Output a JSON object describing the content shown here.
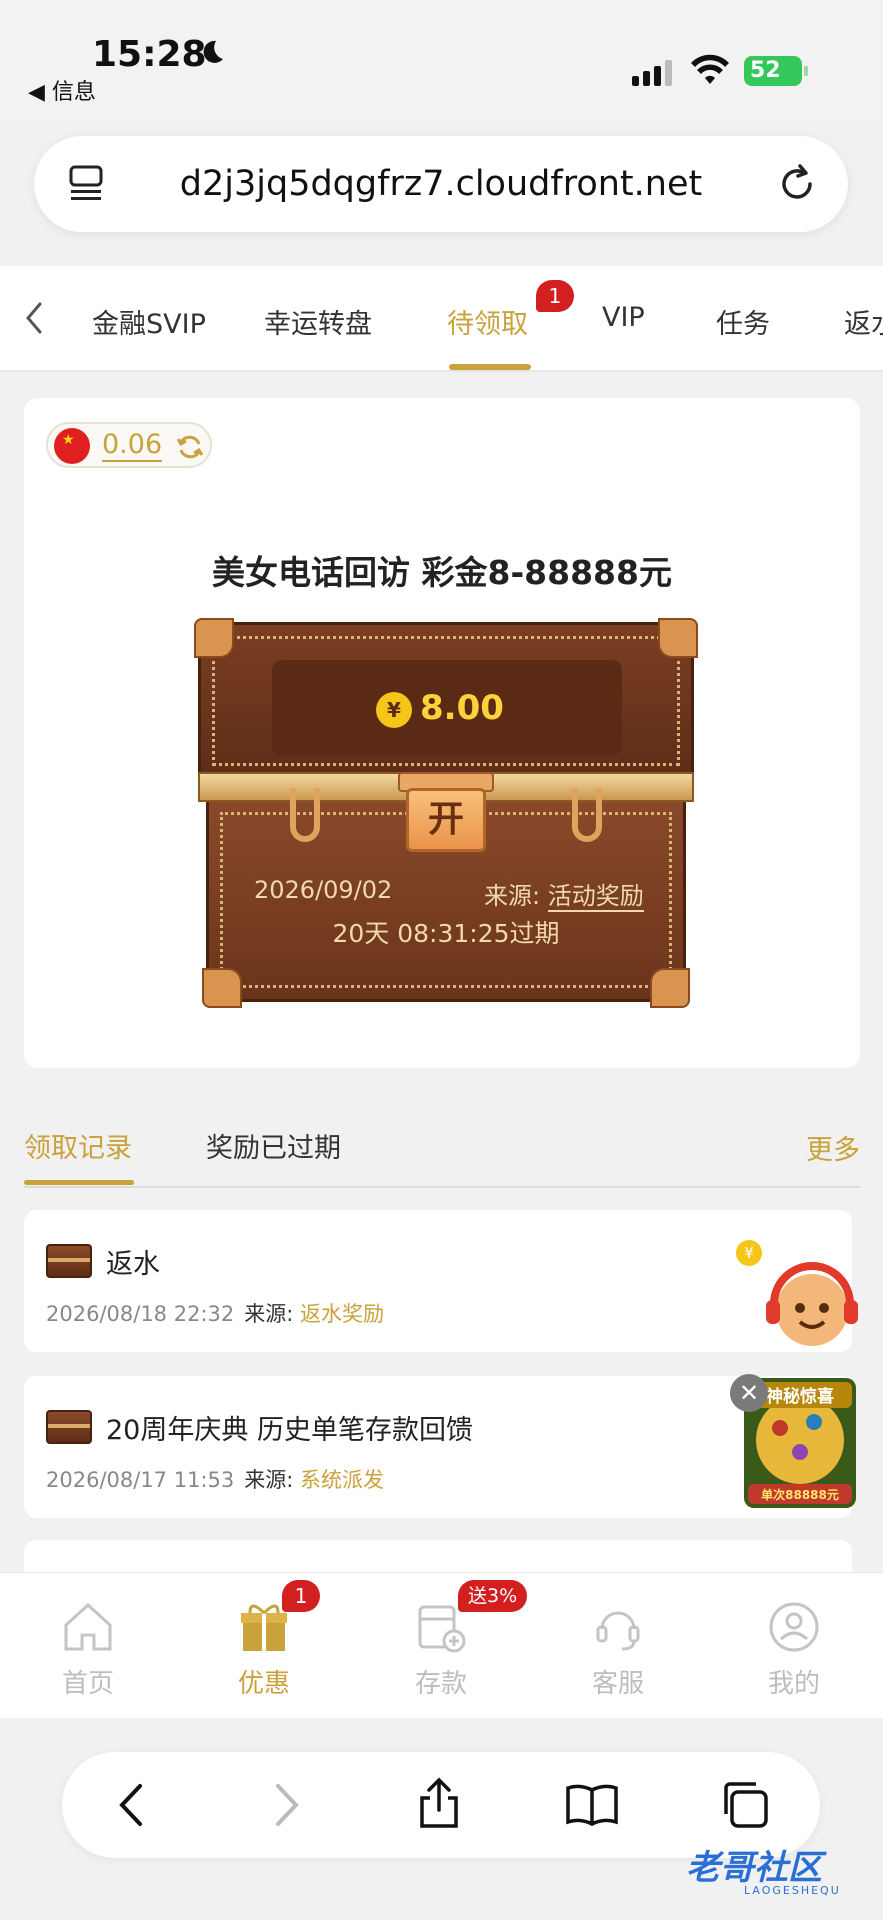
{
  "status_bar": {
    "time": "15:28",
    "back_app": "◀ 信息",
    "battery": "52"
  },
  "browser": {
    "url": "d2j3jq5dqgfrz7.cloudfront.net"
  },
  "tabs": {
    "items": [
      "金融SVIP",
      "幸运转盘",
      "待领取",
      "VIP",
      "任务",
      "返水"
    ],
    "active": "待领取",
    "badge": "1"
  },
  "card": {
    "balance": "0.06",
    "title": "美女电话回访 彩金8-88888元",
    "chest": {
      "currency": "¥",
      "amount": "8.00",
      "lock_label": "开",
      "date": "2026/09/02",
      "source_label": "来源: ",
      "source_value": "活动奖励",
      "expiry": "20天 08:31:25过期"
    }
  },
  "records": {
    "tab_claimed": "领取记录",
    "tab_expired": "奖励已过期",
    "more": "更多",
    "source_label": "来源:",
    "items": [
      {
        "title": "返水",
        "time": "2026/08/18 22:32",
        "source": "返水奖励"
      },
      {
        "title": "20周年庆典 历史单笔存款回馈",
        "time": "2026/08/17 11:53",
        "source": "系统派发"
      }
    ]
  },
  "promo": {
    "close": "✕",
    "headline": "神秘惊喜",
    "subline": "单次88888元"
  },
  "bottom_nav": {
    "items": [
      "首页",
      "优惠",
      "存款",
      "客服",
      "我的"
    ],
    "active": "优惠",
    "promo_badge": "1",
    "deposit_pill": "送3%"
  },
  "watermark": {
    "text": "老哥社区",
    "sub": "LAOGESHEQU"
  },
  "colors": {
    "accent": "#c9a23c",
    "badge": "#d21f1f",
    "chest": "#6a341b"
  }
}
